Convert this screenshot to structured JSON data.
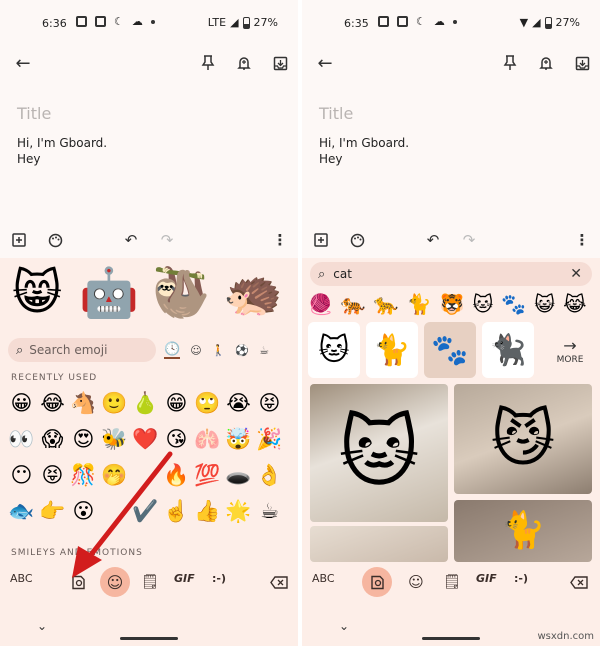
{
  "left": {
    "status": {
      "time": "6:36",
      "network": "LTE",
      "battery": "27%"
    },
    "note": {
      "title_placeholder": "Title",
      "line1": "Hi, I'm Gboard.",
      "line2": "Hey"
    },
    "emoji_search_placeholder": "Search emoji",
    "recently_used_label": "RECENTLY USED",
    "smileys_label": "SMILEYS AND EMOTIONS",
    "recent_emojis": [
      "😀",
      "😂",
      "🐴",
      "🙂",
      "🍐",
      "😁",
      "🙄",
      "😭",
      "😝",
      "👀",
      "😱",
      "😍",
      "🐝",
      "❤️",
      "😘",
      "🫁",
      "🤯",
      "🎉",
      "😶",
      "😝",
      "🎊",
      "🤭",
      "",
      "🔥",
      "💯",
      "🕳️",
      "👌",
      "🐟",
      "👉",
      "😮",
      "",
      "✔️",
      "☝️",
      "👍",
      "🌟",
      "☕"
    ],
    "bottom_bar": {
      "abc": "ABC",
      "gif": "GIF",
      "emoticon": ":-)"
    }
  },
  "right": {
    "status": {
      "time": "6:35",
      "battery": "27%"
    },
    "note": {
      "title_placeholder": "Title",
      "line1": "Hi, I'm Gboard.",
      "line2": "Hey"
    },
    "search_query": "cat",
    "cat_emojis": [
      "🧶",
      "🐅",
      "🐆",
      "🐈",
      "🐯",
      "🐱",
      "🐾",
      "😺",
      "😹"
    ],
    "more_label": "MORE",
    "bottom_bar": {
      "abc": "ABC",
      "gif": "GIF",
      "emoticon": ":-)"
    }
  },
  "colors": {
    "keyboard_bg": "#fdeee8",
    "active_key": "#f6b6a0",
    "arrow": "#d21d1d"
  },
  "watermark": "wsxdn.com"
}
